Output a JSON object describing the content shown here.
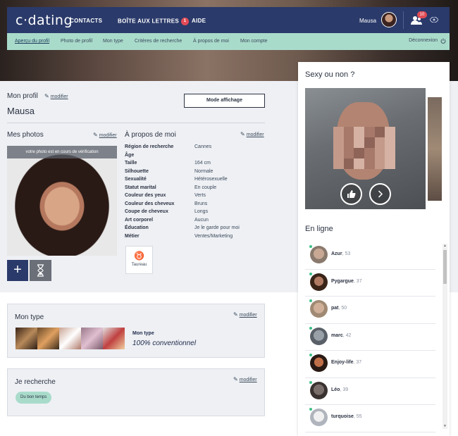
{
  "header": {
    "logo": "c·dating",
    "nav": [
      "CONTACTS",
      "BOÎTE AUX LETTRES",
      "AIDE"
    ],
    "mailbox_badge": "1",
    "username": "Mausa",
    "notifications": "10"
  },
  "subnav": {
    "items": [
      "Aperçu du profil",
      "Photo de profil",
      "Mon type",
      "Critères de recherche",
      "À propos de moi",
      "Mon compte"
    ],
    "logout": "Déconnexion"
  },
  "profile": {
    "heading": "Mon profil",
    "edit_label": "modifier",
    "display_button": "Mode affichage",
    "name": "Mausa"
  },
  "photos": {
    "heading": "Mes photos",
    "edit_label": "modifier",
    "pending_banner": "votre photo est en cours de vérification",
    "add_label": "+"
  },
  "about": {
    "heading": "À propos de moi",
    "edit_label": "modifier",
    "rows": [
      {
        "key": "Région de recherche",
        "value": "Cannes"
      },
      {
        "key": "Âge",
        "value": ""
      },
      {
        "key": "Taille",
        "value": "164 cm"
      },
      {
        "key": "Silhouette",
        "value": "Normale"
      },
      {
        "key": "Sexualité",
        "value": "Hétérosexuelle"
      },
      {
        "key": "Statut marital",
        "value": "En couple"
      },
      {
        "key": "Couleur des yeux",
        "value": "Verts"
      },
      {
        "key": "Couleur des cheveux",
        "value": "Bruns"
      },
      {
        "key": "Coupe de cheveux",
        "value": "Longs"
      },
      {
        "key": "Art corporel",
        "value": "Aucun"
      },
      {
        "key": "Éducation",
        "value": "Je le garde pour moi"
      },
      {
        "key": "Métier",
        "value": "Ventes/Marketing"
      }
    ],
    "zodiac_symbol": "♉",
    "zodiac_name": "Taureau"
  },
  "mon_type": {
    "heading": "Mon type",
    "edit_label": "modifier",
    "label": "Mon type",
    "value": "100% conventionnel"
  },
  "je_recherche": {
    "heading": "Je recherche",
    "edit_label": "modifier",
    "chip": "Du bon temps"
  },
  "sexy": {
    "heading": "Sexy ou non ?",
    "like_icon": "thumbs-up-icon",
    "next_icon": "chevron-right-icon"
  },
  "online": {
    "heading": "En ligne",
    "users": [
      {
        "name": "Azur",
        "age": ", 53"
      },
      {
        "name": "Pygargue",
        "age": ", 37"
      },
      {
        "name": "pat",
        "age": ", 50"
      },
      {
        "name": "marc",
        "age": ", 42"
      },
      {
        "name": "Enjoy-life",
        "age": ", 37"
      },
      {
        "name": "Léo",
        "age": ", 39"
      },
      {
        "name": "turquoise",
        "age": ", 55"
      }
    ]
  },
  "colors": {
    "navy": "#2a3a6a",
    "mint": "#a9dbcb",
    "alert": "#e04b55",
    "online": "#3fbf88"
  }
}
